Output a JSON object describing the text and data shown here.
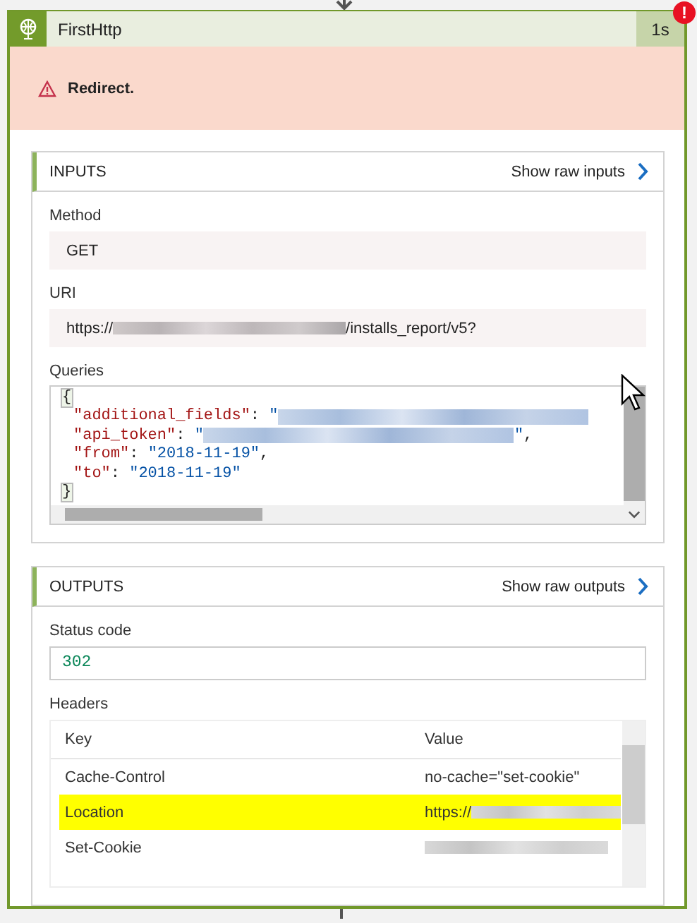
{
  "node": {
    "title": "FirstHttp",
    "duration": "1s",
    "error_badge": "!",
    "banner": {
      "message": "Redirect."
    }
  },
  "inputs": {
    "title": "INPUTS",
    "raw_link": "Show raw inputs",
    "fields": [
      {
        "label": "Method",
        "kind": "text",
        "value": "GET"
      },
      {
        "label": "URI",
        "kind": "masked",
        "parts": [
          {
            "kind": "text",
            "s": "https://"
          },
          {
            "kind": "redacted"
          },
          {
            "kind": "text",
            "s": "/installs_report/v5?"
          }
        ]
      },
      {
        "label": "Queries",
        "kind": "code",
        "lines": [
          [
            {
              "kind": "bracket",
              "s": "{"
            }
          ],
          [
            {
              "kind": "key",
              "s": "\"additional_fields\""
            },
            {
              "kind": "punct",
              "s": ": "
            },
            {
              "kind": "str",
              "s": "\""
            },
            {
              "kind": "redacted"
            }
          ],
          [
            {
              "kind": "key",
              "s": "\"api_token\""
            },
            {
              "kind": "punct",
              "s": ": "
            },
            {
              "kind": "str",
              "s": "\""
            },
            {
              "kind": "redacted"
            },
            {
              "kind": "str",
              "s": "\""
            },
            {
              "kind": "punct",
              "s": ","
            }
          ],
          [
            {
              "kind": "key",
              "s": "\"from\""
            },
            {
              "kind": "punct",
              "s": ": "
            },
            {
              "kind": "str",
              "s": "\"2018-11-19\""
            },
            {
              "kind": "punct",
              "s": ","
            }
          ],
          [
            {
              "kind": "key",
              "s": "\"to\""
            },
            {
              "kind": "punct",
              "s": ": "
            },
            {
              "kind": "str",
              "s": "\"2018-11-19\""
            }
          ],
          [
            {
              "kind": "bracket",
              "s": "}"
            }
          ]
        ]
      }
    ]
  },
  "outputs": {
    "title": "OUTPUTS",
    "raw_link": "Show raw outputs",
    "status": {
      "label": "Status code",
      "value": "302"
    },
    "headers": {
      "label": "Headers",
      "columns": [
        "Key",
        "Value"
      ],
      "rows": [
        {
          "key": "Cache-Control",
          "value": [
            {
              "kind": "text",
              "s": "no-cache=\"set-cookie\""
            }
          ],
          "selected": false
        },
        {
          "key": "Location",
          "value": [
            {
              "kind": "text",
              "s": "https://"
            },
            {
              "kind": "redacted"
            }
          ],
          "selected": true
        },
        {
          "key": "Set-Cookie",
          "value": [
            {
              "kind": "redacted"
            }
          ],
          "selected": false
        }
      ]
    }
  }
}
